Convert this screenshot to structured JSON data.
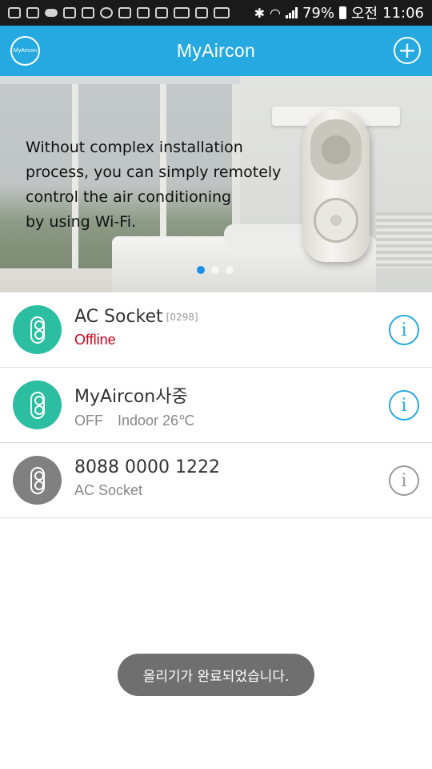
{
  "status_bar": {
    "battery": "79%",
    "ampm": "오전",
    "time": "11:06",
    "icons": [
      "chat-icon",
      "cast-icon",
      "cloud-icon",
      "mail-icon",
      "image-icon",
      "talk-icon",
      "band-icon",
      "band-icon",
      "band-icon",
      "band-icon",
      "band-icon",
      "band-icon",
      "bluetooth-icon",
      "wifi-icon",
      "signal-icon",
      "battery-icon"
    ]
  },
  "appbar": {
    "title": "MyAircon",
    "logo_text": "MyAircon",
    "color": "#25a9e0"
  },
  "banner": {
    "text_lines": [
      "Without complex installation",
      "process, you can simply remotely",
      "control the air conditioning",
      "by using Wi-Fi."
    ],
    "active_dot": 0
  },
  "devices": [
    {
      "name": "AC Socket",
      "code": "[0298]",
      "status": "Offline",
      "status2": "",
      "icon_color": "#2bbea1"
    },
    {
      "name": "MyAircon사중",
      "code": "",
      "status": "OFF",
      "status2": "Indoor 26℃",
      "icon_color": "#2bbea1"
    },
    {
      "name": "8088 0000 1222",
      "code": "",
      "status": "AC Socket",
      "status2": "",
      "icon_color": "#808080"
    }
  ],
  "info_glyph": "i",
  "toast": "올리기가 완료되었습니다."
}
